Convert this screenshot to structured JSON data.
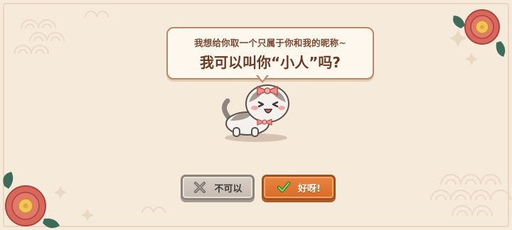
{
  "dialog": {
    "line1": "我想给你取一个只属于你和我的昵称~",
    "line2": "我可以叫你“小人”吗?"
  },
  "buttons": {
    "decline": {
      "label": "不可以",
      "icon": "x-icon"
    },
    "accept": {
      "label": "好呀!",
      "icon": "check-icon"
    }
  },
  "colors": {
    "background": "#f6eadb",
    "accept_button": "#e07a35",
    "decline_button": "#cfc5bc",
    "bubble_border": "#b48a6a",
    "text": "#6b3a24",
    "flower": "#d9675b"
  }
}
